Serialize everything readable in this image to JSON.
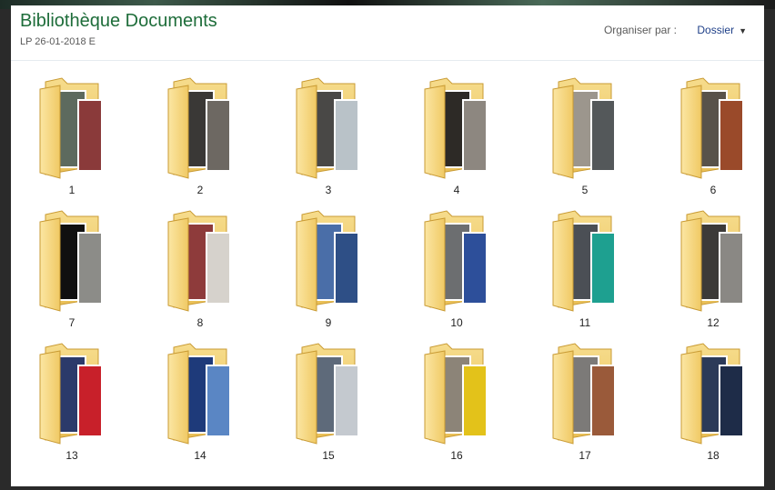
{
  "library": {
    "title": "Bibliothèque Documents",
    "subtitle": "LP 26-01-2018 E"
  },
  "arrange": {
    "label": "Organiser par :",
    "value": "Dossier"
  },
  "folders": [
    {
      "label": "1",
      "photo_a": "#5d6a5e",
      "photo_b": "#8a3a3a"
    },
    {
      "label": "2",
      "photo_a": "#3a3836",
      "photo_b": "#6d6862"
    },
    {
      "label": "3",
      "photo_a": "#494846",
      "photo_b": "#b9c2c8"
    },
    {
      "label": "4",
      "photo_a": "#2d2a26",
      "photo_b": "#8d8780"
    },
    {
      "label": "5",
      "photo_a": "#9c968d",
      "photo_b": "#54585a"
    },
    {
      "label": "6",
      "photo_a": "#58524a",
      "photo_b": "#9a4a2a"
    },
    {
      "label": "7",
      "photo_a": "#101010",
      "photo_b": "#8c8c88"
    },
    {
      "label": "8",
      "photo_a": "#8e3b3b",
      "photo_b": "#d6d2cc"
    },
    {
      "label": "9",
      "photo_a": "#4a6ea8",
      "photo_b": "#2e4f86"
    },
    {
      "label": "10",
      "photo_a": "#6c6e70",
      "photo_b": "#2d4f9a"
    },
    {
      "label": "11",
      "photo_a": "#4b4f55",
      "photo_b": "#1ea090"
    },
    {
      "label": "12",
      "photo_a": "#3c3a38",
      "photo_b": "#8a8884"
    },
    {
      "label": "13",
      "photo_a": "#2b3a6a",
      "photo_b": "#c8202a"
    },
    {
      "label": "14",
      "photo_a": "#1e3a7a",
      "photo_b": "#5a86c4"
    },
    {
      "label": "15",
      "photo_a": "#5e6a7a",
      "photo_b": "#c4c9cf"
    },
    {
      "label": "16",
      "photo_a": "#8c8478",
      "photo_b": "#e3c21a"
    },
    {
      "label": "17",
      "photo_a": "#7c7a78",
      "photo_b": "#9a5a3a"
    },
    {
      "label": "18",
      "photo_a": "#2c3a58",
      "photo_b": "#1e2c48"
    }
  ]
}
